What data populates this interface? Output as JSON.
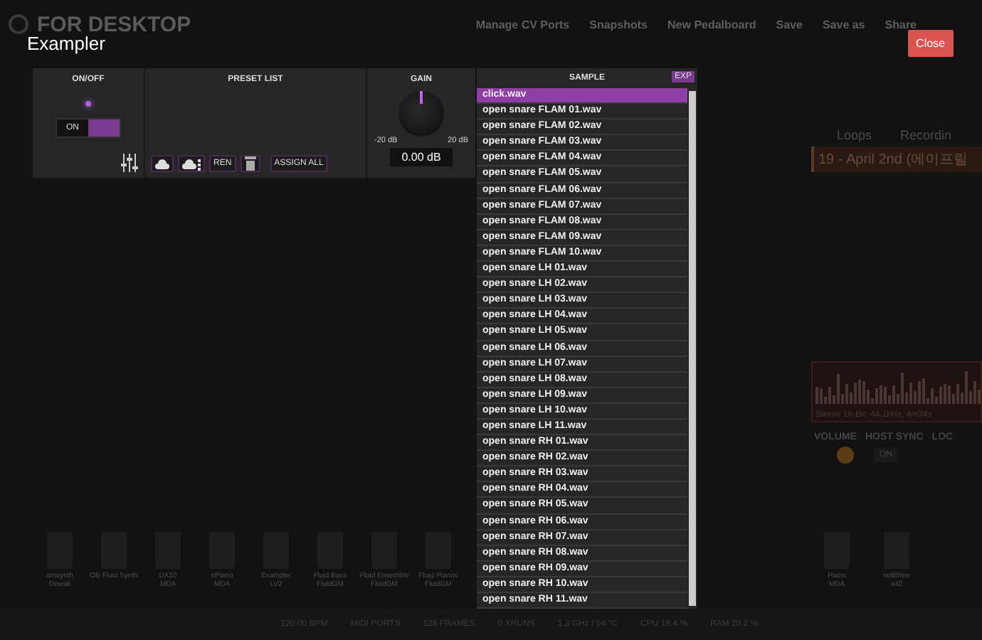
{
  "app": {
    "brand": "FOR DESKTOP",
    "actions": [
      "Manage CV Ports",
      "Snapshots",
      "New Pedalboard",
      "Save",
      "Save as",
      "Share"
    ]
  },
  "player": {
    "tabs": [
      "Loops",
      "Recordin"
    ],
    "track": "19 - April 2nd (에이프릴",
    "info": "Stereo 16-Bit, 44.1kHz, 4m34s",
    "controls": [
      "VOLUME",
      "HOST SYNC",
      "LOC"
    ],
    "sync_button": "ON"
  },
  "pedals_left": [
    {
      "name": "amsynth",
      "maker": "Dowall"
    },
    {
      "name": "OB Fluid Synth"
    },
    {
      "name": "DX10",
      "maker": "MDA"
    },
    {
      "name": "ePiano",
      "maker": "MDA"
    },
    {
      "name": "Exampler",
      "maker": "LV2"
    },
    {
      "name": "Fluid Bass",
      "maker": "FluidGM"
    },
    {
      "name": "Fluid Ensemble",
      "maker": "FluidGM"
    },
    {
      "name": "Fluid Pianos",
      "maker": "FluidGM"
    }
  ],
  "pedals_right": [
    {
      "name": "Piano",
      "maker": "MDA"
    },
    {
      "name": "setBfree",
      "maker": "x42"
    }
  ],
  "status_bar": [
    "120.00 BPM",
    "MIDI PORTS",
    "128 FRAMES",
    "0 XRUNS",
    "1.3 GHz / 54 °C",
    "CPU 19.4 %",
    "RAM 20.2 %"
  ],
  "modal": {
    "title": "Exampler",
    "close": "Close",
    "onoff": {
      "label": "ON/OFF",
      "on": true,
      "button": "ON"
    },
    "preset": {
      "label": "PRESET LIST",
      "rename": "REN",
      "assign": "ASSIGN ALL"
    },
    "gain": {
      "label": "GAIN",
      "min": "-20 dB",
      "max": "20 dB",
      "value": "0.00 dB",
      "level": 0.5
    },
    "sample": {
      "label": "SAMPLE",
      "exp": "EXP",
      "files": [
        {
          "name": "click.wav",
          "selected": true
        },
        {
          "name": "open snare FLAM 01.wav",
          "selected": false
        },
        {
          "name": "open snare FLAM 02.wav",
          "selected": false
        },
        {
          "name": "open snare FLAM 03.wav",
          "selected": false
        },
        {
          "name": "open snare FLAM 04.wav",
          "selected": false
        },
        {
          "name": "open snare FLAM 05.wav",
          "selected": false
        },
        {
          "name": "open snare FLAM 06.wav",
          "selected": false
        },
        {
          "name": "open snare FLAM 07.wav",
          "selected": false
        },
        {
          "name": "open snare FLAM 08.wav",
          "selected": false
        },
        {
          "name": "open snare FLAM 09.wav",
          "selected": false
        },
        {
          "name": "open snare FLAM 10.wav",
          "selected": false
        },
        {
          "name": "open snare LH 01.wav",
          "selected": false
        },
        {
          "name": "open snare LH 02.wav",
          "selected": false
        },
        {
          "name": "open snare LH 03.wav",
          "selected": false
        },
        {
          "name": "open snare LH 04.wav",
          "selected": false
        },
        {
          "name": "open snare LH 05.wav",
          "selected": false
        },
        {
          "name": "open snare LH 06.wav",
          "selected": false
        },
        {
          "name": "open snare LH 07.wav",
          "selected": false
        },
        {
          "name": "open snare LH 08.wav",
          "selected": false
        },
        {
          "name": "open snare LH 09.wav",
          "selected": false
        },
        {
          "name": "open snare LH 10.wav",
          "selected": false
        },
        {
          "name": "open snare LH 11.wav",
          "selected": false
        },
        {
          "name": "open snare RH 01.wav",
          "selected": false
        },
        {
          "name": "open snare RH 02.wav",
          "selected": false
        },
        {
          "name": "open snare RH 03.wav",
          "selected": false
        },
        {
          "name": "open snare RH 04.wav",
          "selected": false
        },
        {
          "name": "open snare RH 05.wav",
          "selected": false
        },
        {
          "name": "open snare RH 06.wav",
          "selected": false
        },
        {
          "name": "open snare RH 07.wav",
          "selected": false
        },
        {
          "name": "open snare RH 08.wav",
          "selected": false
        },
        {
          "name": "open snare RH 09.wav",
          "selected": false
        },
        {
          "name": "open snare RH 10.wav",
          "selected": false
        },
        {
          "name": "open snare RH 11.wav",
          "selected": false
        }
      ]
    }
  }
}
